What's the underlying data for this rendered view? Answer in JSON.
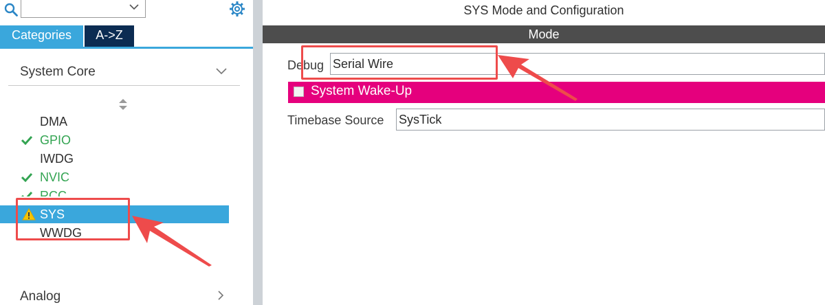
{
  "sidebar": {
    "search": {
      "value": "",
      "placeholder": ""
    },
    "tabs": [
      {
        "label": "Categories"
      },
      {
        "label": "A->Z"
      }
    ],
    "section": {
      "title": "System Core"
    },
    "items": [
      {
        "label": "DMA",
        "status": "none"
      },
      {
        "label": "GPIO",
        "status": "configured"
      },
      {
        "label": "IWDG",
        "status": "none"
      },
      {
        "label": "NVIC",
        "status": "configured"
      },
      {
        "label": "RCC",
        "status": "configured"
      },
      {
        "label": "SYS",
        "status": "warning",
        "selected": true
      },
      {
        "label": "WWDG",
        "status": "none"
      }
    ],
    "next_section": {
      "title": "Analog"
    }
  },
  "config": {
    "title": "SYS Mode and Configuration",
    "mode_header": "Mode",
    "debug": {
      "label": "Debug",
      "value": "Serial Wire"
    },
    "wakeup": {
      "label": "System Wake-Up",
      "checked": false
    },
    "timebase": {
      "label": "Timebase Source",
      "value": "SysTick"
    }
  },
  "colors": {
    "accent_blue": "#3aa7dc",
    "tab_dark": "#0c2c52",
    "mode_bar": "#4d4d4d",
    "wakeup_bar": "#e5007d",
    "configured_green": "#33a452",
    "annotation_red": "#ee4b4b"
  }
}
